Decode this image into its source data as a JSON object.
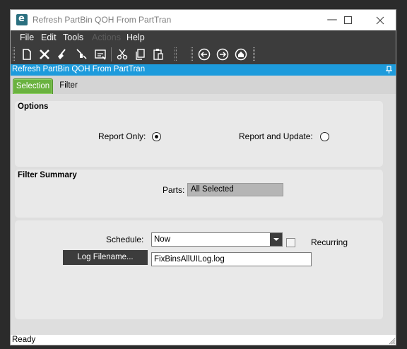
{
  "window": {
    "title": "Refresh PartBin QOH From PartTran",
    "app_icon_letter": "e",
    "minimize_glyph": "—",
    "maximize_glyph": "☐",
    "close_glyph": "✕"
  },
  "menu": {
    "items": [
      {
        "label": "File",
        "enabled": true
      },
      {
        "label": "Edit",
        "enabled": true
      },
      {
        "label": "Tools",
        "enabled": true
      },
      {
        "label": "Actions",
        "enabled": false
      },
      {
        "label": "Help",
        "enabled": true
      }
    ]
  },
  "toolbar": {
    "buttons": [
      "new-icon",
      "delete-icon",
      "clear-icon",
      "print-icon",
      "print-preview-icon",
      "cut-icon",
      "copy-icon",
      "paste-icon",
      "back-icon",
      "forward-icon",
      "home-icon"
    ]
  },
  "panel": {
    "title": "Refresh PartBin QOH From PartTran"
  },
  "tabs": [
    {
      "label": "Selection",
      "active": true
    },
    {
      "label": "Filter",
      "active": false
    }
  ],
  "options": {
    "title": "Options",
    "report_only_label": "Report Only:",
    "report_only_selected": true,
    "report_update_label": "Report and Update:",
    "report_update_selected": false
  },
  "filter_summary": {
    "title": "Filter Summary",
    "parts_label": "Parts:",
    "parts_value": "All Selected"
  },
  "schedule": {
    "label": "Schedule:",
    "value": "Now",
    "recurring_label": "Recurring",
    "recurring_checked": false,
    "log_button_label": "Log Filename...",
    "log_filename": "FixBinsAllUILog.log"
  },
  "status": {
    "text": "Ready"
  },
  "colors": {
    "accent_blue": "#1d9bdc",
    "tab_green": "#6ab23f",
    "dark_bar": "#3c3c3c"
  }
}
